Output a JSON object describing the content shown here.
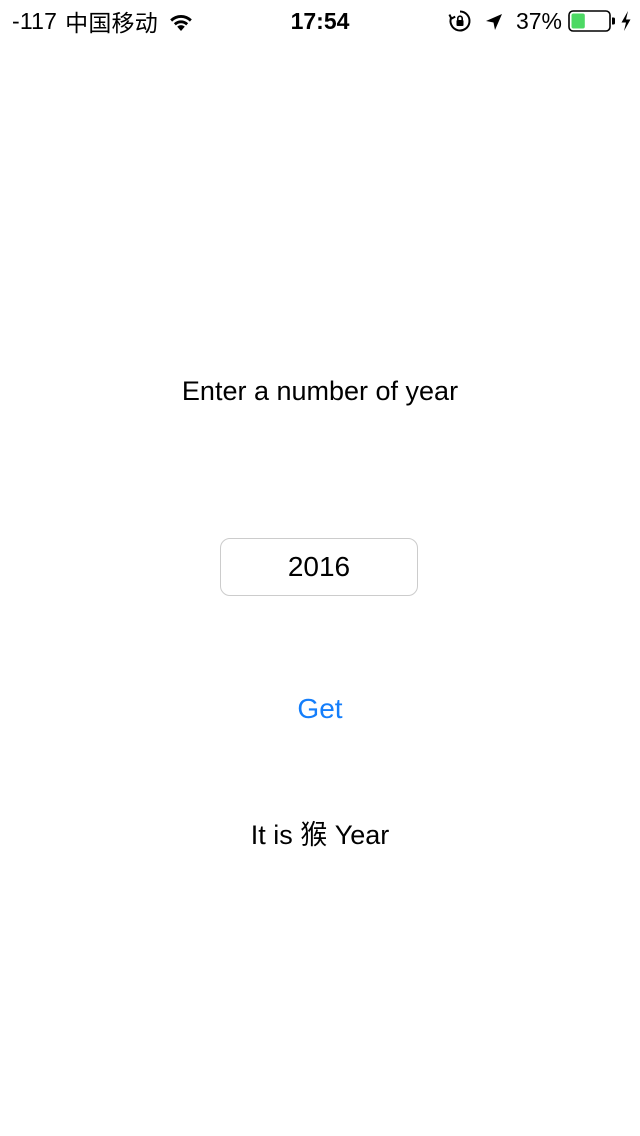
{
  "status_bar": {
    "signal": "-117",
    "carrier": "中国移动",
    "time": "17:54",
    "battery_percent": "37%",
    "battery_level": 0.37,
    "icons": [
      "wifi-icon",
      "lock-rotation-icon",
      "location-icon",
      "battery-icon",
      "charging-icon"
    ],
    "battery_color": "#4cd964"
  },
  "main": {
    "prompt": "Enter a number of year",
    "year_input_value": "2016",
    "get_button_label": "Get",
    "result_text": "It is 猴 Year"
  },
  "colors": {
    "accent": "#147efb",
    "background": "#ffffff",
    "text": "#000000",
    "input_border": "#cccccc"
  }
}
